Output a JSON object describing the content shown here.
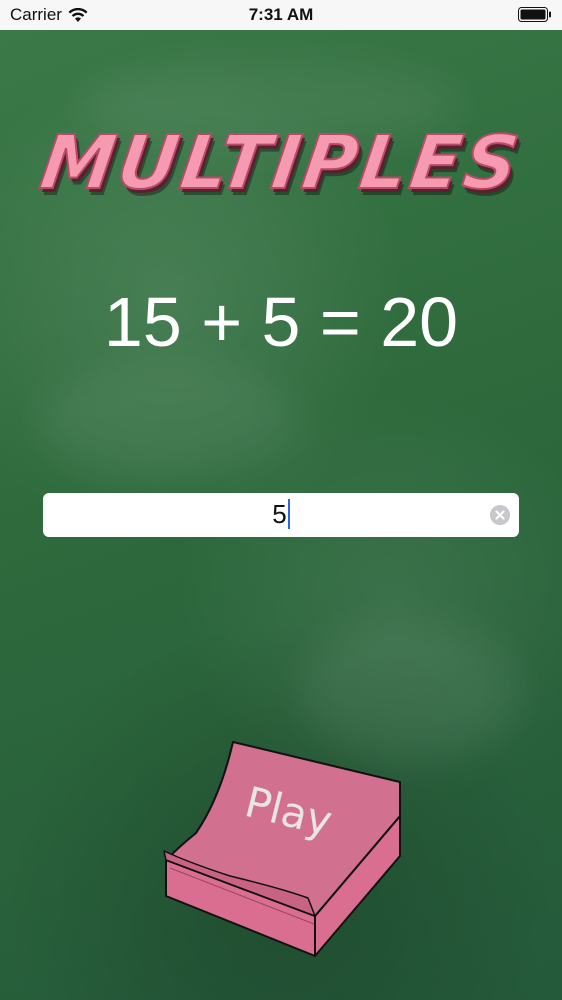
{
  "status_bar": {
    "carrier": "Carrier",
    "time": "7:31 AM",
    "icons": [
      "wifi-icon",
      "battery-icon"
    ]
  },
  "app": {
    "title": "MULTIPLES",
    "equation": "15 + 5 = 20",
    "answer_value": "5",
    "play_label": "Play"
  },
  "colors": {
    "chalkboard": "#2f6b3e",
    "title_pink": "#f59ab0",
    "book_pink": "#d2708f",
    "caret_blue": "#2f64e6"
  }
}
